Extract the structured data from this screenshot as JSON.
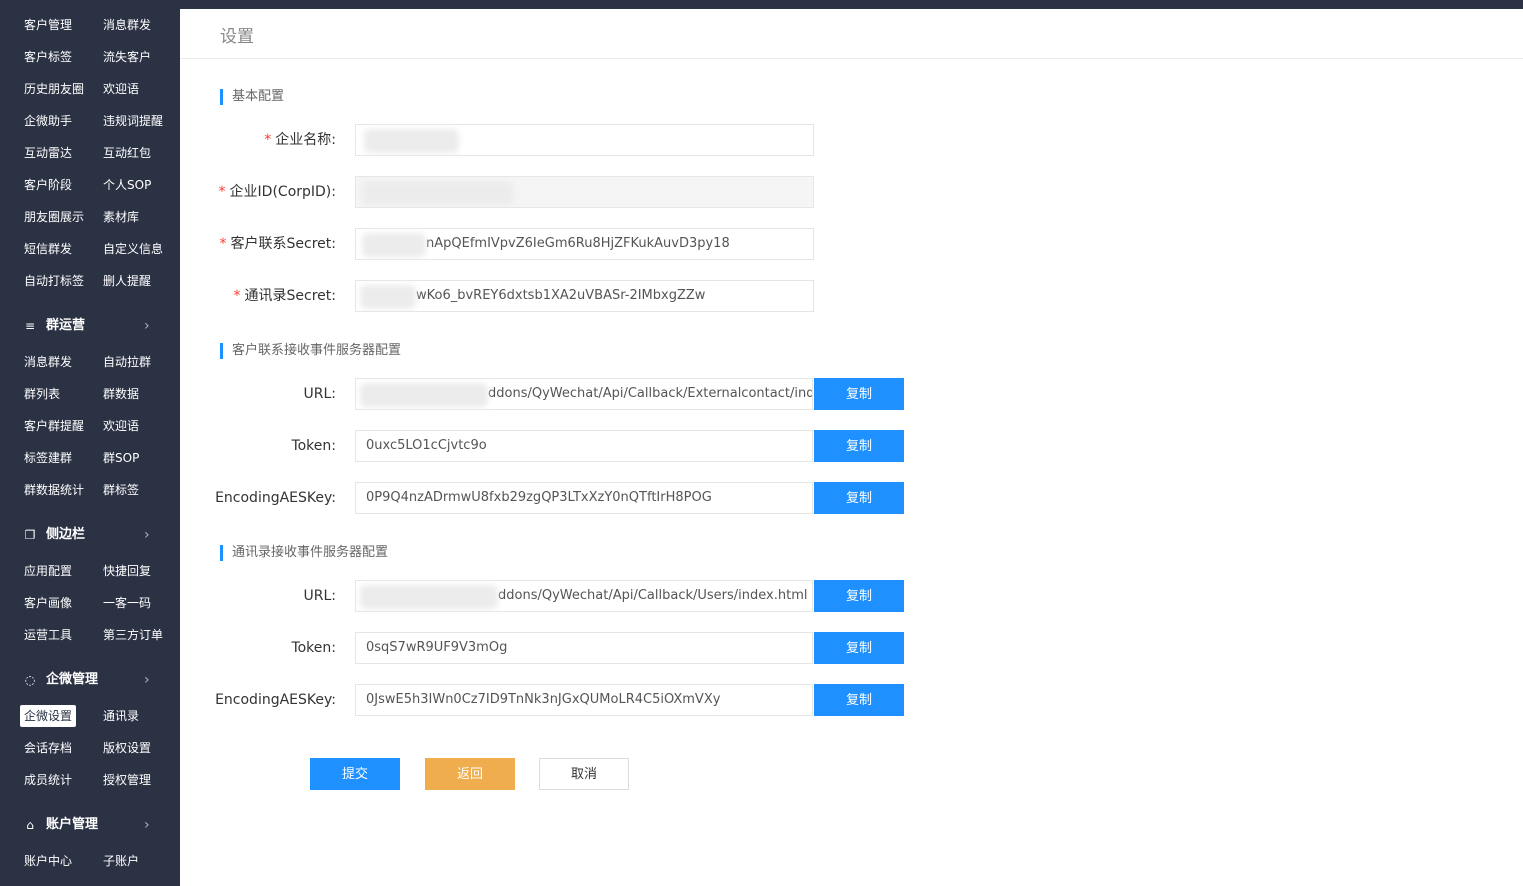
{
  "sidebar": {
    "rows_top": [
      [
        "客户管理",
        "消息群发"
      ],
      [
        "客户标签",
        "流失客户"
      ],
      [
        "历史朋友圈",
        "欢迎语"
      ],
      [
        "企微助手",
        "违规词提醒"
      ],
      [
        "互动雷达",
        "互动红包"
      ],
      [
        "客户阶段",
        "个人SOP"
      ],
      [
        "朋友圈展示",
        "素材库"
      ],
      [
        "短信群发",
        "自定义信息"
      ],
      [
        "自动打标签",
        "删人提醒"
      ]
    ],
    "group_qun": {
      "label": "群运营",
      "icon": "list-icon",
      "chevron": "›"
    },
    "rows_qun": [
      [
        "消息群发",
        "自动拉群"
      ],
      [
        "群列表",
        "群数据"
      ],
      [
        "客户群提醒",
        "欢迎语"
      ],
      [
        "标签建群",
        "群SOP"
      ],
      [
        "群数据统计",
        "群标签"
      ]
    ],
    "group_side": {
      "label": "侧边栏",
      "icon": "window-icon",
      "chevron": "›"
    },
    "rows_side": [
      [
        "应用配置",
        "快捷回复"
      ],
      [
        "客户画像",
        "一客一码"
      ],
      [
        "运营工具",
        "第三方订单"
      ]
    ],
    "group_qw": {
      "label": "企微管理",
      "icon": "chat-icon",
      "chevron": "›"
    },
    "rows_qw": [
      [
        "企微设置",
        "通讯录"
      ],
      [
        "会话存档",
        "版权设置"
      ],
      [
        "成员统计",
        "授权管理"
      ]
    ],
    "group_acct": {
      "label": "账户管理",
      "icon": "home-icon",
      "chevron": "›"
    },
    "rows_acct": [
      [
        "账户中心",
        "子账户"
      ]
    ]
  },
  "page": {
    "title": "设置"
  },
  "basic": {
    "title": "基本配置",
    "corp_name_label": "企业名称:",
    "corp_id_label": "企业ID(CorpID):",
    "contact_secret_label": "客户联系Secret:",
    "contact_secret_value": "nApQEfmIVpvZ6IeGm6Ru8HjZFKukAuvD3py18",
    "addressbook_secret_label": "通讯录Secret:",
    "addressbook_secret_value": "wKo6_bvREY6dxtsb1XA2uVBASr-2IMbxgZZw"
  },
  "contact_server": {
    "title": "客户联系接收事件服务器配置",
    "url_label": "URL:",
    "url_value": "ddons/QyWechat/Api/Callback/Externalcontact/inde",
    "token_label": "Token:",
    "token_value": "0uxc5LO1cCjvtc9o",
    "aes_label": "EncodingAESKey:",
    "aes_value": "0P9Q4nzADrmwU8fxb29zgQP3LTxXzY0nQTftIrH8POG"
  },
  "users_server": {
    "title": "通讯录接收事件服务器配置",
    "url_label": "URL:",
    "url_value": "ddons/QyWechat/Api/Callback/Users/index.html",
    "token_label": "Token:",
    "token_value": "0sqS7wR9UF9V3mOg",
    "aes_label": "EncodingAESKey:",
    "aes_value": "0JswE5h3IWn0Cz7ID9TnNk3nJGxQUMoLR4C5iOXmVXy"
  },
  "buttons": {
    "copy": "复制",
    "submit": "提交",
    "back": "返回",
    "cancel": "取消"
  },
  "required_mark": "*"
}
